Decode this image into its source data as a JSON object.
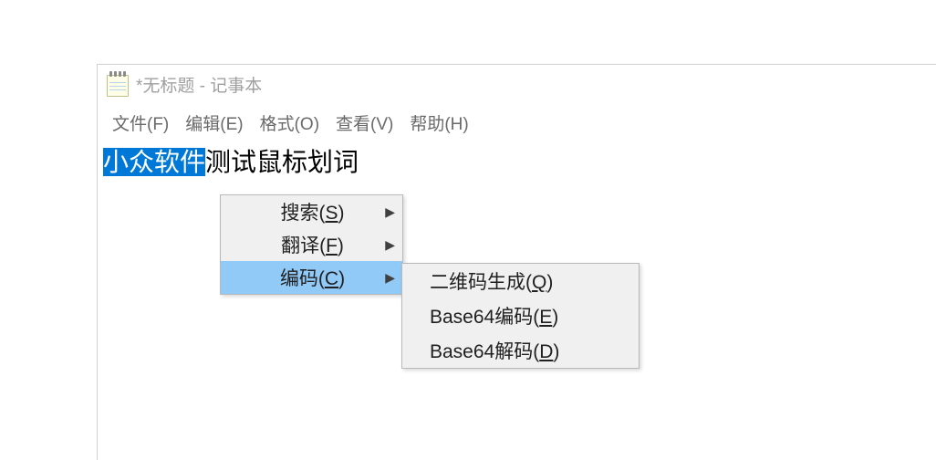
{
  "title": "*无标题 - 记事本",
  "menubar": {
    "file": "文件(F)",
    "edit": "编辑(E)",
    "format": "格式(O)",
    "view": "查看(V)",
    "help": "帮助(H)"
  },
  "editor": {
    "selected": "小众软件",
    "rest": "测试鼠标划词"
  },
  "context_menu": {
    "items": [
      {
        "label_pre": "搜索(",
        "key": "S",
        "label_post": ")",
        "has_sub": true,
        "highlighted": false
      },
      {
        "label_pre": "翻译(",
        "key": "F",
        "label_post": ")",
        "has_sub": true,
        "highlighted": false
      },
      {
        "label_pre": "编码(",
        "key": "C",
        "label_post": ")",
        "has_sub": true,
        "highlighted": true
      }
    ]
  },
  "submenu": {
    "items": [
      {
        "label_pre": "二维码生成(",
        "key": "Q",
        "label_post": ")"
      },
      {
        "label_pre": "Base64编码(",
        "key": "E",
        "label_post": ")"
      },
      {
        "label_pre": "Base64解码(",
        "key": "D",
        "label_post": ")"
      }
    ]
  }
}
